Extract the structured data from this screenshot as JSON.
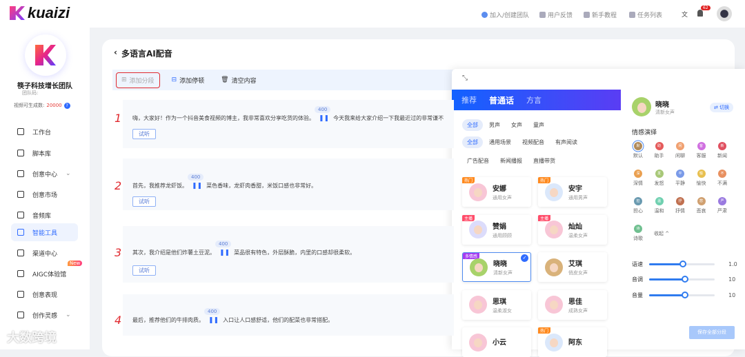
{
  "brand": {
    "name": "kuaizi"
  },
  "header": {
    "links": [
      "加入/创建团队",
      "用户反馈",
      "新手教程",
      "任务列表"
    ],
    "notification_count": "62"
  },
  "sidebar": {
    "team_name": "筷子科技增长团队",
    "team_code_label": "团队码:",
    "video_quota_label": "视频可生成数:",
    "video_quota_value": "20000",
    "items": [
      {
        "label": "工作台"
      },
      {
        "label": "脚本库"
      },
      {
        "label": "创意中心"
      },
      {
        "label": "创意市场"
      },
      {
        "label": "音频库"
      },
      {
        "label": "智能工具"
      },
      {
        "label": "渠道中心"
      },
      {
        "label": "AIGC体验馆",
        "badge": "New"
      },
      {
        "label": "创意表现"
      },
      {
        "label": "创作灵感"
      }
    ]
  },
  "page": {
    "title": "多语言AI配音",
    "toolbar": {
      "add_segment": "添加分段",
      "add_pause": "添加停顿",
      "clear": "清空内容"
    },
    "segments": [
      {
        "num": "1",
        "before": "嗨，大家好！作为一个抖音美食视频的博主，我非常喜欢分享吃货的体验。",
        "pause": "400",
        "after": "今天我来给大家介绍一下我最近过的非常谦不",
        "try": "试听"
      },
      {
        "num": "2",
        "before": "首先，我推荐龙虾饭。",
        "pause": "400",
        "after": "菜色香味，龙虾肉香甜，米饭口感也非常好。",
        "try": "试听"
      },
      {
        "num": "3",
        "before": "其次，我介绍是他们炸薯土豆泥。",
        "pause": "400",
        "after": "菜品很有特色，外层酥脆，内里的口感却很柔软。",
        "try": "试听"
      },
      {
        "num": "4",
        "before": "最后，推荐他们的牛排肉质。",
        "pause": "400",
        "after": "入口让人口感舒适，他们的配菜也非常搭配。",
        "try": "试听"
      }
    ]
  },
  "voice_panel": {
    "tabs": [
      "推荐",
      "普通话",
      "方言"
    ],
    "active_tab": "普通话",
    "filters": {
      "gender": [
        "全部",
        "男声",
        "女声",
        "童声"
      ],
      "scene": [
        "全部",
        "通用场景",
        "视频配音",
        "有声阅读",
        "广告配音",
        "新闻播报",
        "直播带货"
      ]
    },
    "voices": [
      {
        "name": "安娜",
        "desc": "通用女声",
        "tag": "热门",
        "tagcolor": "#ff8a1f",
        "av": "#f8c6d6"
      },
      {
        "name": "安宇",
        "desc": "通用男声",
        "tag": "热门",
        "tagcolor": "#ff8a1f",
        "av": "#dbe8fb"
      },
      {
        "name": "赞娟",
        "desc": "通用顾顾",
        "tag": "主播",
        "tagcolor": "#ff4d6a",
        "av": "#dcdcfb"
      },
      {
        "name": "灿灿",
        "desc": "温柔女声",
        "tag": "主播",
        "tagcolor": "#ff4d6a",
        "av": "#f8c6d6"
      },
      {
        "name": "晓晓",
        "desc": "清新女声",
        "tag": "多情感",
        "tagcolor": "#a63cf0",
        "av": "#a8d26a",
        "selected": true
      },
      {
        "name": "艾琪",
        "desc": "俏皮女声",
        "tag": "",
        "av": "#d9b27a"
      },
      {
        "name": "思琪",
        "desc": "温柔淑女",
        "tag": "",
        "av": "#f8c6d6"
      },
      {
        "name": "思佳",
        "desc": "成熟女声",
        "tag": "",
        "av": "#f8c6d6"
      },
      {
        "name": "小云",
        "desc": "",
        "tag": "",
        "av": "#f8c6d6"
      },
      {
        "name": "阿东",
        "desc": "",
        "tag": "热门",
        "tagcolor": "#ff8a1f",
        "av": "#dbe8fb"
      }
    ]
  },
  "selected_voice": {
    "name": "晓晓",
    "desc": "清新女声",
    "switch": "切换",
    "emotion_title": "情感演绎",
    "emotions": [
      {
        "l": "默认",
        "c": "#b08a5a"
      },
      {
        "l": "助手",
        "c": "#e55b5b"
      },
      {
        "l": "闲聊",
        "c": "#f0a070"
      },
      {
        "l": "客服",
        "c": "#d070e0"
      },
      {
        "l": "新闻",
        "c": "#e05060"
      },
      {
        "l": "深情",
        "c": "#eaa050"
      },
      {
        "l": "发怒",
        "c": "#a8c878"
      },
      {
        "l": "平静",
        "c": "#7a9ae8"
      },
      {
        "l": "愉快",
        "c": "#e8c050"
      },
      {
        "l": "不满",
        "c": "#e89060"
      },
      {
        "l": "担心",
        "c": "#6a9ab0"
      },
      {
        "l": "温和",
        "c": "#70d0b0"
      },
      {
        "l": "抒情",
        "c": "#c07050"
      },
      {
        "l": "悲哀",
        "c": "#d0a070"
      },
      {
        "l": "严肃",
        "c": "#9a7ae0"
      },
      {
        "l": "诗歌",
        "c": "#70c090"
      }
    ],
    "collapse": "收起",
    "sliders": [
      {
        "label": "语速",
        "value": "1.0",
        "fraction": 0.52
      },
      {
        "label": "音调",
        "value": "10",
        "fraction": 0.55
      },
      {
        "label": "音量",
        "value": "10",
        "fraction": 0.55
      }
    ],
    "save": "保存全部分段"
  },
  "watermark": "大数跨境"
}
